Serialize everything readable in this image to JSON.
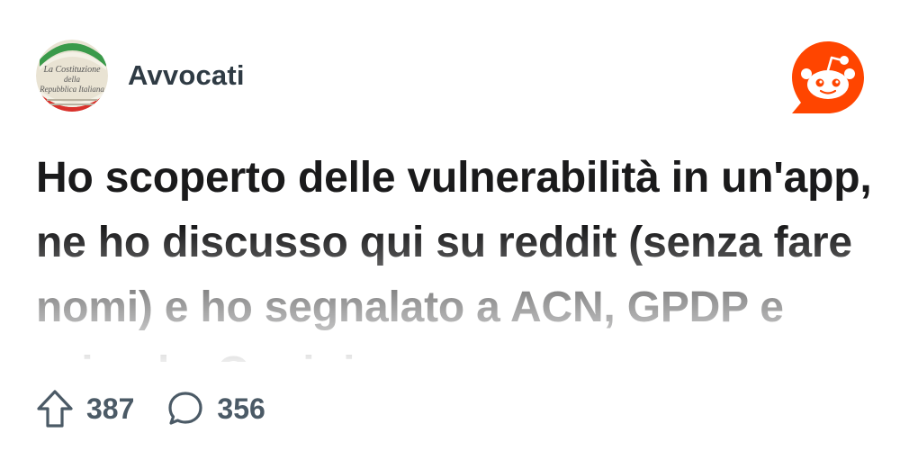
{
  "post": {
    "community": "Avvocati",
    "community_avatar_text": [
      "La Costituzione",
      "della",
      "Repubblica Italiana"
    ],
    "title": "Ho scoperto delle vulnerabilità in un'app, ne ho discusso qui su reddit (senza fare nomi) e ho segnalato a ACN, GPDP e azienda. Oggi ricevo",
    "upvotes": "387",
    "comments": "356"
  },
  "icons": {
    "upvote": "arrow-up-outline-icon",
    "comments": "speech-bubble-icon",
    "brand": "reddit-logo-icon"
  },
  "colors": {
    "reddit_orange": "#ff4500",
    "text_primary": "#1a1a1b",
    "text_secondary": "#4b5a66",
    "flag_green": "#3a9a4a",
    "flag_red": "#d9312b"
  }
}
